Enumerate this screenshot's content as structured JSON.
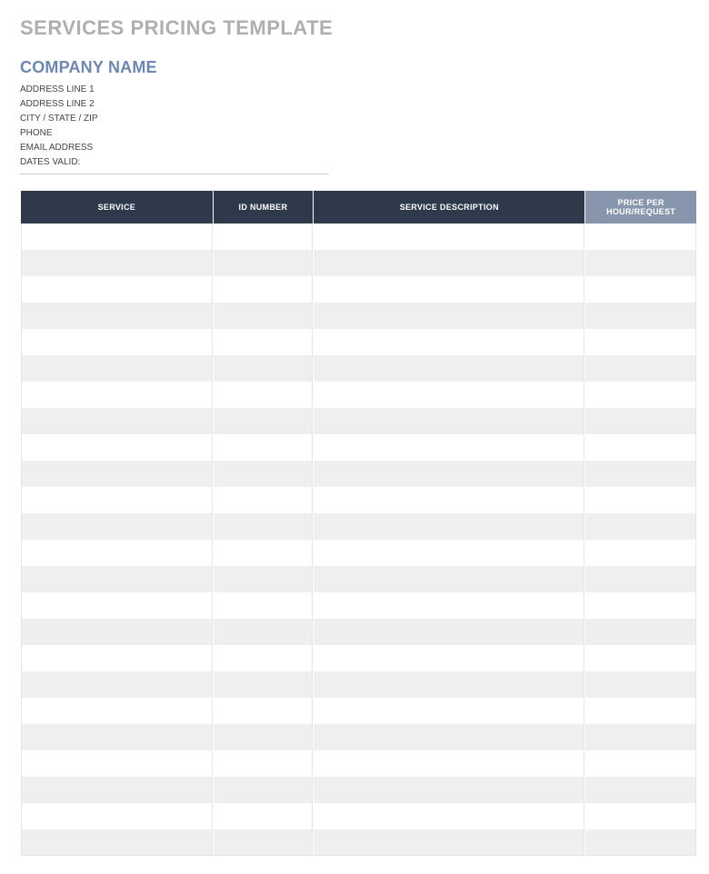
{
  "header": {
    "title": "SERVICES PRICING TEMPLATE",
    "company_name": "COMPANY NAME",
    "info_lines": [
      "ADDRESS LINE 1",
      "ADDRESS LINE 2",
      "CITY / STATE / ZIP",
      "PHONE",
      "EMAIL ADDRESS",
      "DATES VALID:"
    ]
  },
  "table": {
    "columns": {
      "service": "SERVICE",
      "id_number": "ID NUMBER",
      "description": "SERVICE DESCRIPTION",
      "price": "PRICE PER HOUR/REQUEST"
    },
    "rows": [
      {
        "service": "",
        "id_number": "",
        "description": "",
        "price": ""
      },
      {
        "service": "",
        "id_number": "",
        "description": "",
        "price": ""
      },
      {
        "service": "",
        "id_number": "",
        "description": "",
        "price": ""
      },
      {
        "service": "",
        "id_number": "",
        "description": "",
        "price": ""
      },
      {
        "service": "",
        "id_number": "",
        "description": "",
        "price": ""
      },
      {
        "service": "",
        "id_number": "",
        "description": "",
        "price": ""
      },
      {
        "service": "",
        "id_number": "",
        "description": "",
        "price": ""
      },
      {
        "service": "",
        "id_number": "",
        "description": "",
        "price": ""
      },
      {
        "service": "",
        "id_number": "",
        "description": "",
        "price": ""
      },
      {
        "service": "",
        "id_number": "",
        "description": "",
        "price": ""
      },
      {
        "service": "",
        "id_number": "",
        "description": "",
        "price": ""
      },
      {
        "service": "",
        "id_number": "",
        "description": "",
        "price": ""
      },
      {
        "service": "",
        "id_number": "",
        "description": "",
        "price": ""
      },
      {
        "service": "",
        "id_number": "",
        "description": "",
        "price": ""
      },
      {
        "service": "",
        "id_number": "",
        "description": "",
        "price": ""
      },
      {
        "service": "",
        "id_number": "",
        "description": "",
        "price": ""
      },
      {
        "service": "",
        "id_number": "",
        "description": "",
        "price": ""
      },
      {
        "service": "",
        "id_number": "",
        "description": "",
        "price": ""
      },
      {
        "service": "",
        "id_number": "",
        "description": "",
        "price": ""
      },
      {
        "service": "",
        "id_number": "",
        "description": "",
        "price": ""
      },
      {
        "service": "",
        "id_number": "",
        "description": "",
        "price": ""
      },
      {
        "service": "",
        "id_number": "",
        "description": "",
        "price": ""
      },
      {
        "service": "",
        "id_number": "",
        "description": "",
        "price": ""
      },
      {
        "service": "",
        "id_number": "",
        "description": "",
        "price": ""
      }
    ]
  }
}
